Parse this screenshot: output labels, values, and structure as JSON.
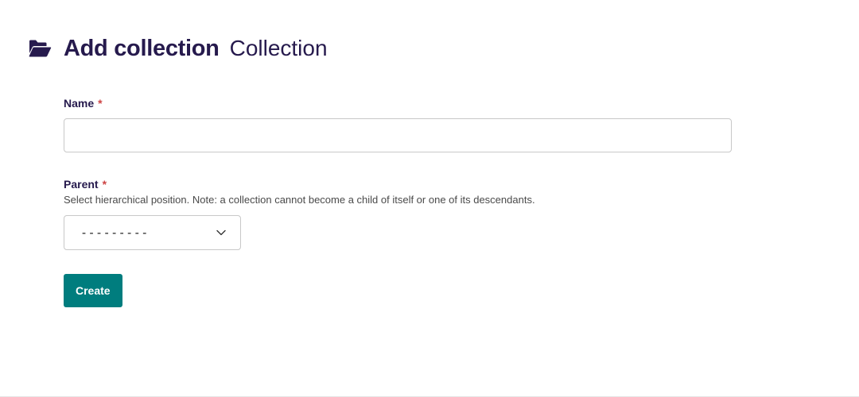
{
  "header": {
    "icon": "folder-open-icon",
    "title": "Add collection",
    "subtitle": "Collection"
  },
  "form": {
    "name_field": {
      "label": "Name",
      "required_marker": "*",
      "value": ""
    },
    "parent_field": {
      "label": "Parent",
      "required_marker": "*",
      "help_text": "Select hierarchical position. Note: a collection cannot become a child of itself or one of its descendants.",
      "selected_value": "---------",
      "icon": "chevron-down-icon"
    },
    "submit_label": "Create"
  },
  "colors": {
    "primary_text": "#261a4d",
    "required": "#cd4444",
    "button": "#007d7e"
  }
}
